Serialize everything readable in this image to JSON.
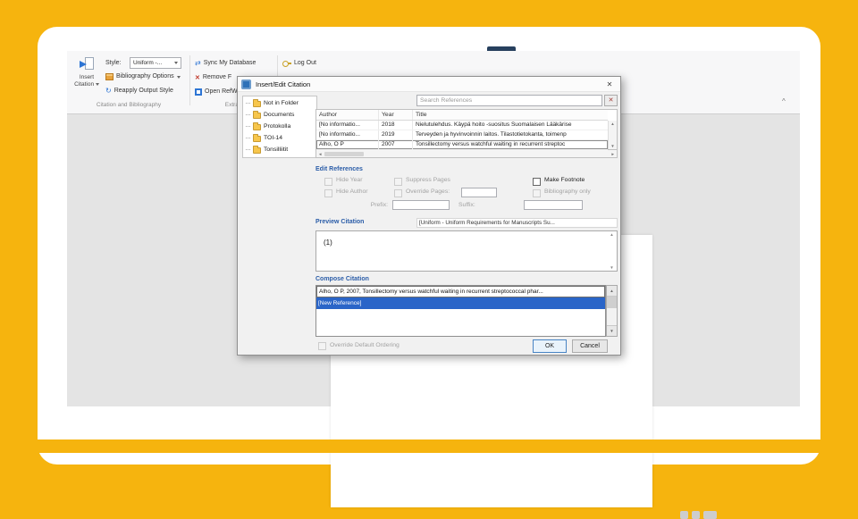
{
  "ribbon": {
    "insert_citation": {
      "line1": "Insert",
      "line2": "Citation"
    },
    "style_label": "Style:",
    "style_value": "Uniform -...",
    "bibliography_options": "Bibliography Options",
    "reapply_output_style": "Reapply Output Style",
    "sync_my_database": "Sync My Database",
    "remove_field": "Remove F",
    "open_refworks": "Open RefW",
    "log_out": "Log Out",
    "groups": {
      "citation": "Citation and Bibliography",
      "extras": "Extras"
    }
  },
  "dialog": {
    "title": "Insert/Edit Citation",
    "search": {
      "placeholder": "Search References"
    },
    "folders": [
      "Not in Folder",
      "Documents",
      "Protokolla",
      "TOI-14",
      "Tonsilliitit"
    ],
    "table": {
      "columns": [
        "Author",
        "Year",
        "Title"
      ],
      "rows": [
        {
          "author": "[No informatio...",
          "year": "2018",
          "title": "Nielutulehdus. Käypä hoito -suositus Suomalaisen Lääkärise"
        },
        {
          "author": "[No informatio...",
          "year": "2019",
          "title": "Terveyden ja hyvinvoinnin laitos. Tilastotietokanta, toimenp"
        },
        {
          "author": "Alho, O P",
          "year": "2007",
          "title": "Tonsillectomy versus watchful waiting in recurrent streptoc"
        }
      ]
    },
    "edit_references": {
      "label": "Edit References",
      "hide_year": "Hide Year",
      "hide_author": "Hide Author",
      "suppress_pages": "Suppress Pages",
      "override_pages": "Override Pages:",
      "prefix": "Prefix:",
      "suffix": "Suffix:",
      "make_footnote": "Make Footnote",
      "bibliography_only": "Bibliography only"
    },
    "preview": {
      "label": "Preview Citation",
      "style": "[Uniform - Uniform Requirements for Manuscripts Su...",
      "content": "(1)"
    },
    "compose": {
      "label": "Compose Citation",
      "items": [
        "Alho, O P, 2007, Tonsillectomy versus watchful waiting in recurrent streptococcal phar...",
        "[New Reference]"
      ]
    },
    "footer": {
      "override_ordering": "Override Default Ordering",
      "ok": "OK",
      "cancel": "Cancel"
    }
  },
  "icons": {
    "close": "✕",
    "clear_search": "✕",
    "refresh": "↻",
    "sync": "⇄",
    "remove": "✕",
    "up": "▲",
    "down": "▼",
    "left": "◄",
    "right": "►",
    "collapse": "^"
  },
  "colors": {
    "accent_yellow": "#F6B40E",
    "selection_blue": "#2A65C8",
    "link_blue": "#2B5DA8"
  }
}
